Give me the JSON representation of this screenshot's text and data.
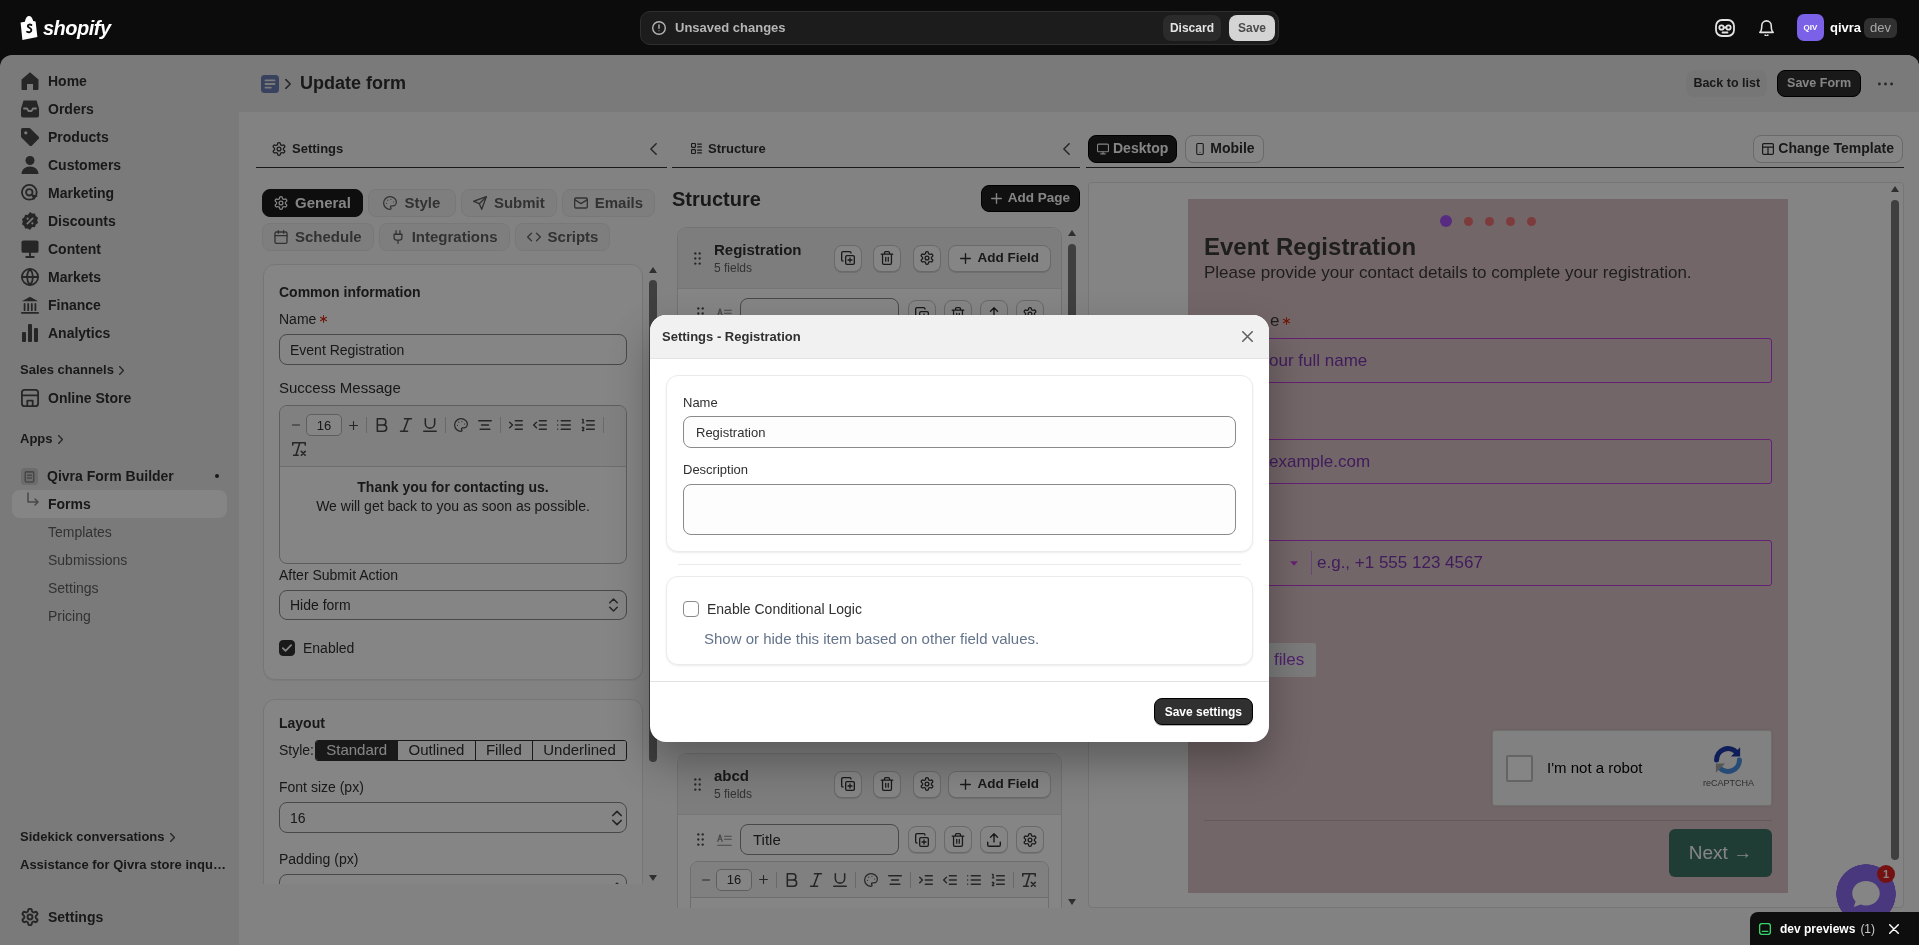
{
  "top_bar": {
    "brand": "shopify",
    "save_bar": {
      "message": "Unsaved changes",
      "discard_button": "Discard",
      "save_button": "Save"
    },
    "account": {
      "initials": "QIV",
      "name": "qivra",
      "badge": "dev"
    }
  },
  "sidebar": {
    "items": [
      {
        "label": "Home",
        "selected": false
      },
      {
        "label": "Orders",
        "selected": false
      },
      {
        "label": "Products",
        "selected": false
      },
      {
        "label": "Customers",
        "selected": false
      },
      {
        "label": "Marketing",
        "selected": false
      },
      {
        "label": "Discounts",
        "selected": false
      },
      {
        "label": "Content",
        "selected": false
      },
      {
        "label": "Markets",
        "selected": false
      },
      {
        "label": "Finance",
        "selected": false
      },
      {
        "label": "Analytics",
        "selected": false
      }
    ],
    "sales_channels": {
      "heading": "Sales channels",
      "items": [
        {
          "label": "Online Store",
          "selected": false
        }
      ]
    },
    "apps": {
      "heading": "Apps",
      "items": [
        {
          "label": "Qivra Form Builder",
          "selected": false,
          "children": [
            {
              "label": "Forms",
              "selected": true
            },
            {
              "label": "Templates",
              "selected": false
            },
            {
              "label": "Submissions",
              "selected": false
            },
            {
              "label": "Settings",
              "selected": false
            },
            {
              "label": "Pricing",
              "selected": false
            }
          ]
        }
      ]
    },
    "sidekick": {
      "heading": "Sidekick conversations",
      "items": [
        {
          "label": "Assistance for Qivra store inqu…",
          "selected": false
        }
      ]
    },
    "bottom_items": [
      {
        "label": "Settings",
        "selected": false
      }
    ]
  },
  "page_header": {
    "title": "Update form",
    "back_button": "Back to list",
    "save_button": "Save Form"
  },
  "settings_panel": {
    "title": "Settings",
    "tabs": [
      {
        "label": "General",
        "selected": true
      },
      {
        "label": "Style",
        "selected": false
      },
      {
        "label": "Submit",
        "selected": false
      },
      {
        "label": "Emails",
        "selected": false
      },
      {
        "label": "Schedule",
        "selected": false
      },
      {
        "label": "Integrations",
        "selected": false
      },
      {
        "label": "Scripts",
        "selected": false
      }
    ],
    "common": {
      "heading": "Common information",
      "name": {
        "label": "Name",
        "required": true,
        "value": "Event Registration"
      },
      "success_message": {
        "label": "Success Message",
        "font_size": "16",
        "lines": [
          {
            "text": "Thank you for contacting us.",
            "bold": true
          },
          {
            "text": "We will get back to you as soon as possible.",
            "bold": false
          }
        ]
      },
      "after_submit": {
        "label": "After Submit Action",
        "value": "Hide form"
      },
      "enabled": {
        "label": "Enabled",
        "checked": true
      }
    },
    "layout": {
      "heading": "Layout",
      "style": {
        "label": "Style:",
        "options": [
          {
            "label": "Standard",
            "selected": true
          },
          {
            "label": "Outlined",
            "selected": false
          },
          {
            "label": "Filled",
            "selected": false
          },
          {
            "label": "Underlined",
            "selected": false
          }
        ]
      },
      "font_size": {
        "label": "Font size (px)",
        "value": "16"
      },
      "padding": {
        "label": "Padding (px)"
      }
    }
  },
  "structure_panel": {
    "title": "Structure",
    "heading": "Structure",
    "add_page_button": "Add Page",
    "pages": [
      {
        "name": "Registration",
        "count": "5 fields",
        "add_field_button": "Add Field",
        "fields": [
          {
            "kind": "title"
          }
        ]
      },
      {
        "name": "abcd",
        "count": "5 fields",
        "add_field_button": "Add Field",
        "fields": [
          {
            "kind": "title",
            "title": "Title",
            "font_size": "16"
          }
        ]
      }
    ]
  },
  "preview_panel": {
    "tabs": [
      {
        "label": "Desktop",
        "selected": true
      },
      {
        "label": "Mobile",
        "selected": false
      }
    ],
    "change_template_button": "Change Template",
    "form": {
      "steps": [
        {
          "selected": true
        },
        {
          "selected": false
        },
        {
          "selected": false
        },
        {
          "selected": false
        },
        {
          "selected": false
        }
      ],
      "title": "Event Registration",
      "description": "Please provide your contact details to complete your registration.",
      "fields": [
        {
          "kind": "text",
          "label": "e",
          "required": true,
          "placeholder": "our full name"
        },
        {
          "kind": "text",
          "placeholder": "example.com"
        },
        {
          "kind": "phone",
          "placeholder": "e.g., +1 555 123 4567"
        },
        {
          "kind": "file",
          "button": "files"
        }
      ],
      "captcha": {
        "label": "I'm not a robot",
        "brand": "reCAPTCHA",
        "checked": false
      },
      "next_button": "Next →"
    },
    "chat_widget": {
      "badge": "1"
    }
  },
  "dev_previews": {
    "label": "dev previews",
    "count": "(1)"
  },
  "modal": {
    "title": "Settings - Registration",
    "name": {
      "label": "Name",
      "value": "Registration"
    },
    "description": {
      "label": "Description"
    },
    "conditional_logic": {
      "label": "Enable Conditional Logic",
      "checked": false,
      "hint": "Show or hide this item based on other field values."
    },
    "save_button": "Save settings"
  }
}
